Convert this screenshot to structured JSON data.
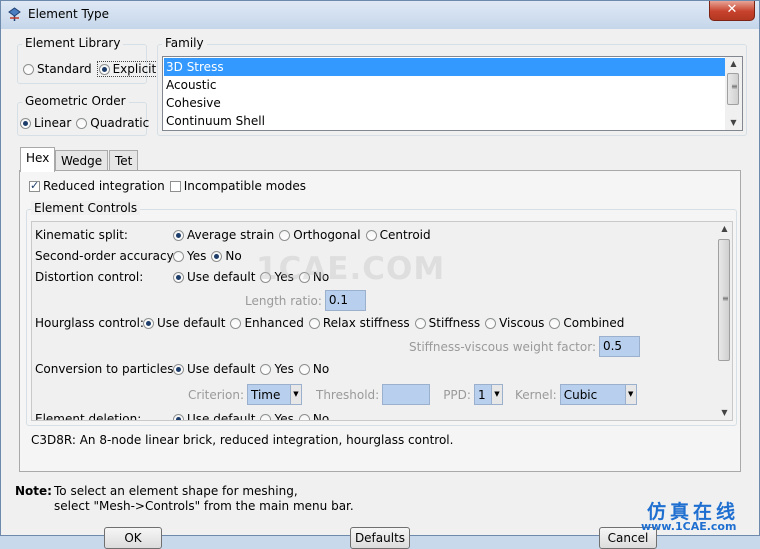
{
  "window": {
    "title": "Element Type",
    "close_label": "✕"
  },
  "element_library": {
    "label": "Element Library",
    "options": [
      "Standard",
      "Explicit"
    ],
    "selected": "Explicit"
  },
  "geometric_order": {
    "label": "Geometric Order",
    "options": [
      "Linear",
      "Quadratic"
    ],
    "selected": "Linear"
  },
  "family": {
    "label": "Family",
    "items": [
      "3D Stress",
      "Acoustic",
      "Cohesive",
      "Continuum Shell"
    ],
    "selected": "3D Stress"
  },
  "tabs": [
    {
      "label": "Hex",
      "active": true
    },
    {
      "label": "Wedge",
      "active": false
    },
    {
      "label": "Tet",
      "active": false
    }
  ],
  "hex_options": {
    "reduced_integration": {
      "label": "Reduced integration",
      "checked": true
    },
    "incompatible_modes": {
      "label": "Incompatible modes",
      "checked": false
    }
  },
  "element_controls": {
    "label": "Element Controls",
    "kinematic_split": {
      "label": "Kinematic split:",
      "options": [
        "Average strain",
        "Orthogonal",
        "Centroid"
      ],
      "selected": "Average strain"
    },
    "second_order_accuracy": {
      "label": "Second-order accuracy:",
      "options": [
        "Yes",
        "No"
      ],
      "selected": "No"
    },
    "distortion_control": {
      "label": "Distortion control:",
      "options": [
        "Use default",
        "Yes",
        "No"
      ],
      "selected": "Use default",
      "length_ratio_label": "Length ratio:",
      "length_ratio_value": "0.1"
    },
    "hourglass_control": {
      "label": "Hourglass control:",
      "options": [
        "Use default",
        "Enhanced",
        "Relax stiffness",
        "Stiffness",
        "Viscous",
        "Combined"
      ],
      "selected": "Use default",
      "weight_factor_label": "Stiffness-viscous weight factor:",
      "weight_factor_value": "0.5"
    },
    "conversion_to_particles": {
      "label": "Conversion to particles:",
      "options": [
        "Use default",
        "Yes",
        "No"
      ],
      "selected": "Use default",
      "criterion_label": "Criterion:",
      "criterion_value": "Time",
      "threshold_label": "Threshold:",
      "threshold_value": "",
      "ppd_label": "PPD:",
      "ppd_value": "1",
      "kernel_label": "Kernel:",
      "kernel_value": "Cubic"
    },
    "element_deletion": {
      "label": "Element deletion:",
      "options": [
        "Use default",
        "Yes",
        "No"
      ],
      "selected": "Use default"
    }
  },
  "description": "C3D8R:  An 8-node linear brick, reduced integration, hourglass control.",
  "note": {
    "label": "Note:",
    "line1": "To select an element shape for meshing,",
    "line2": "select \"Mesh->Controls\" from the main menu bar."
  },
  "buttons": {
    "ok": "OK",
    "defaults": "Defaults",
    "cancel": "Cancel"
  },
  "watermark": "1CAE.COM",
  "corner_logo": {
    "cn": "仿真在线",
    "url": "www.1CAE.com"
  },
  "colors": {
    "selection": "#3399ff",
    "field": "#b8d0ee",
    "title_bar": "#dfe9f5"
  }
}
